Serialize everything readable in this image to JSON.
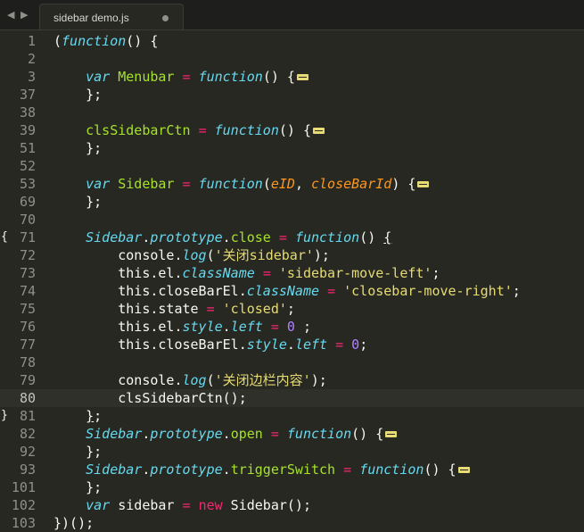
{
  "tab": {
    "title": "sidebar demo.js",
    "nav_left": "◀",
    "nav_right": "▶"
  },
  "lines": [
    {
      "num": "1",
      "fold": "",
      "tokens": [
        [
          "p",
          "("
        ],
        [
          "k",
          "function"
        ],
        [
          "p",
          "() {"
        ]
      ]
    },
    {
      "num": "2",
      "fold": "",
      "tokens": []
    },
    {
      "num": "3",
      "fold": "",
      "tokens": [
        [
          "p",
          "    "
        ],
        [
          "k",
          "var"
        ],
        [
          "p",
          " "
        ],
        [
          "f",
          "Menubar"
        ],
        [
          "p",
          " "
        ],
        [
          "o",
          "="
        ],
        [
          "p",
          " "
        ],
        [
          "k",
          "function"
        ],
        [
          "p",
          "() {"
        ],
        [
          "fm",
          ""
        ]
      ]
    },
    {
      "num": "37",
      "fold": "",
      "tokens": [
        [
          "p",
          "    };"
        ]
      ]
    },
    {
      "num": "38",
      "fold": "",
      "tokens": []
    },
    {
      "num": "39",
      "fold": "",
      "tokens": [
        [
          "p",
          "    "
        ],
        [
          "f",
          "clsSidebarCtn"
        ],
        [
          "p",
          " "
        ],
        [
          "o",
          "="
        ],
        [
          "p",
          " "
        ],
        [
          "k",
          "function"
        ],
        [
          "p",
          "() {"
        ],
        [
          "fm",
          ""
        ]
      ]
    },
    {
      "num": "51",
      "fold": "",
      "tokens": [
        [
          "p",
          "    };"
        ]
      ]
    },
    {
      "num": "52",
      "fold": "",
      "tokens": []
    },
    {
      "num": "53",
      "fold": "",
      "tokens": [
        [
          "p",
          "    "
        ],
        [
          "k",
          "var"
        ],
        [
          "p",
          " "
        ],
        [
          "f",
          "Sidebar"
        ],
        [
          "p",
          " "
        ],
        [
          "o",
          "="
        ],
        [
          "p",
          " "
        ],
        [
          "k",
          "function"
        ],
        [
          "p",
          "("
        ],
        [
          "pm",
          "eID"
        ],
        [
          "p",
          ", "
        ],
        [
          "pm",
          "closeBarId"
        ],
        [
          "p",
          ") {"
        ],
        [
          "fm",
          ""
        ]
      ]
    },
    {
      "num": "69",
      "fold": "",
      "tokens": [
        [
          "p",
          "    };"
        ]
      ]
    },
    {
      "num": "70",
      "fold": "",
      "tokens": []
    },
    {
      "num": "71",
      "fold": "{",
      "tokens": [
        [
          "p",
          "    "
        ],
        [
          "k",
          "Sidebar"
        ],
        [
          "p",
          "."
        ],
        [
          "k",
          "prototype"
        ],
        [
          "p",
          "."
        ],
        [
          "f",
          "close"
        ],
        [
          "p",
          " "
        ],
        [
          "o",
          "="
        ],
        [
          "p",
          " "
        ],
        [
          "k",
          "function"
        ],
        [
          "p",
          "() "
        ],
        [
          "u",
          "{"
        ]
      ]
    },
    {
      "num": "72",
      "fold": "",
      "tokens": [
        [
          "p",
          "        console."
        ],
        [
          "k",
          "log"
        ],
        [
          "p",
          "("
        ],
        [
          "s",
          "'关闭sidebar'"
        ],
        [
          "p",
          ");"
        ]
      ]
    },
    {
      "num": "73",
      "fold": "",
      "tokens": [
        [
          "p",
          "        this.el."
        ],
        [
          "k",
          "className"
        ],
        [
          "p",
          " "
        ],
        [
          "o",
          "="
        ],
        [
          "p",
          " "
        ],
        [
          "s",
          "'sidebar-move-left'"
        ],
        [
          "p",
          ";"
        ]
      ]
    },
    {
      "num": "74",
      "fold": "",
      "tokens": [
        [
          "p",
          "        this.closeBarEl."
        ],
        [
          "k",
          "className"
        ],
        [
          "p",
          " "
        ],
        [
          "o",
          "="
        ],
        [
          "p",
          " "
        ],
        [
          "s",
          "'closebar-move-right'"
        ],
        [
          "p",
          ";"
        ]
      ]
    },
    {
      "num": "75",
      "fold": "",
      "tokens": [
        [
          "p",
          "        this.state "
        ],
        [
          "o",
          "="
        ],
        [
          "p",
          " "
        ],
        [
          "s",
          "'closed'"
        ],
        [
          "p",
          ";"
        ]
      ]
    },
    {
      "num": "76",
      "fold": "",
      "tokens": [
        [
          "p",
          "        this.el."
        ],
        [
          "k",
          "style"
        ],
        [
          "p",
          "."
        ],
        [
          "k",
          "left"
        ],
        [
          "p",
          " "
        ],
        [
          "o",
          "="
        ],
        [
          "p",
          " "
        ],
        [
          "n",
          "0"
        ],
        [
          "p",
          " ;"
        ]
      ]
    },
    {
      "num": "77",
      "fold": "",
      "tokens": [
        [
          "p",
          "        this.closeBarEl."
        ],
        [
          "k",
          "style"
        ],
        [
          "p",
          "."
        ],
        [
          "k",
          "left"
        ],
        [
          "p",
          " "
        ],
        [
          "o",
          "="
        ],
        [
          "p",
          " "
        ],
        [
          "n",
          "0"
        ],
        [
          "p",
          ";"
        ]
      ]
    },
    {
      "num": "78",
      "fold": "",
      "tokens": []
    },
    {
      "num": "79",
      "fold": "",
      "tokens": [
        [
          "p",
          "        console."
        ],
        [
          "k",
          "log"
        ],
        [
          "p",
          "("
        ],
        [
          "s",
          "'关闭边栏内容'"
        ],
        [
          "p",
          ");"
        ]
      ]
    },
    {
      "num": "80",
      "fold": "",
      "current": true,
      "tokens": [
        [
          "p",
          "        clsSidebarCtn();"
        ]
      ]
    },
    {
      "num": "81",
      "fold": "}",
      "tokens": [
        [
          "p",
          "    "
        ],
        [
          "u",
          "}"
        ],
        [
          "p",
          ";"
        ]
      ]
    },
    {
      "num": "82",
      "fold": "",
      "tokens": [
        [
          "p",
          "    "
        ],
        [
          "k",
          "Sidebar"
        ],
        [
          "p",
          "."
        ],
        [
          "k",
          "prototype"
        ],
        [
          "p",
          "."
        ],
        [
          "f",
          "open"
        ],
        [
          "p",
          " "
        ],
        [
          "o",
          "="
        ],
        [
          "p",
          " "
        ],
        [
          "k",
          "function"
        ],
        [
          "p",
          "() {"
        ],
        [
          "fm",
          ""
        ]
      ]
    },
    {
      "num": "92",
      "fold": "",
      "tokens": [
        [
          "p",
          "    };"
        ]
      ]
    },
    {
      "num": "93",
      "fold": "",
      "tokens": [
        [
          "p",
          "    "
        ],
        [
          "k",
          "Sidebar"
        ],
        [
          "p",
          "."
        ],
        [
          "k",
          "prototype"
        ],
        [
          "p",
          "."
        ],
        [
          "f",
          "triggerSwitch"
        ],
        [
          "p",
          " "
        ],
        [
          "o",
          "="
        ],
        [
          "p",
          " "
        ],
        [
          "k",
          "function"
        ],
        [
          "p",
          "() {"
        ],
        [
          "fm",
          ""
        ]
      ]
    },
    {
      "num": "101",
      "fold": "",
      "tokens": [
        [
          "p",
          "    };"
        ]
      ]
    },
    {
      "num": "102",
      "fold": "",
      "tokens": [
        [
          "p",
          "    "
        ],
        [
          "k",
          "var"
        ],
        [
          "p",
          " sidebar "
        ],
        [
          "o",
          "="
        ],
        [
          "p",
          " "
        ],
        [
          "o",
          "new"
        ],
        [
          "p",
          " Sidebar();"
        ]
      ]
    },
    {
      "num": "103",
      "fold": "",
      "tokens": [
        [
          "p",
          "})();"
        ]
      ]
    }
  ]
}
